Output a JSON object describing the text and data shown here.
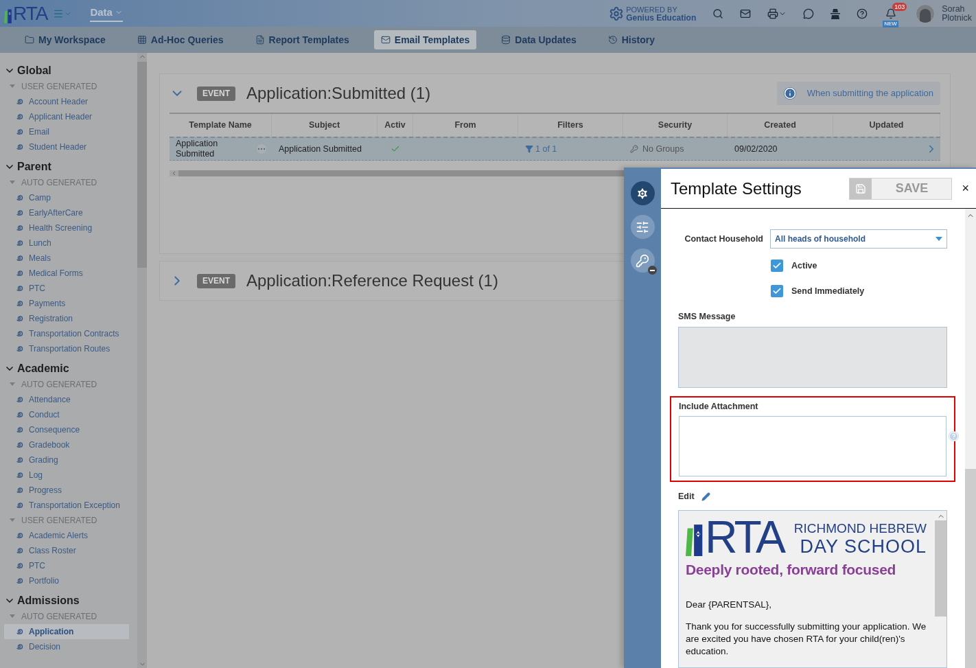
{
  "topbar": {
    "logo": "RTA",
    "menu_label": "Data",
    "powered_by": "POWERED BY",
    "powered_name": "Genius Education",
    "notifications": "103",
    "new_badge": "NEW",
    "user_first": "Sorah",
    "user_last": "Plotnick"
  },
  "nav": [
    {
      "label": "My Workspace",
      "selected": false
    },
    {
      "label": "Ad-Hoc Queries",
      "selected": false
    },
    {
      "label": "Report Templates",
      "selected": false
    },
    {
      "label": "Email Templates",
      "selected": true
    },
    {
      "label": "Data Updates",
      "selected": false
    },
    {
      "label": "History",
      "selected": false
    }
  ],
  "sidebar": [
    {
      "title": "Global",
      "expanded": true,
      "groups": [
        {
          "title": "USER GENERATED",
          "expanded": true,
          "items": [
            {
              "label": "Account Header",
              "selected": false
            },
            {
              "label": "Applicant Header",
              "selected": false
            },
            {
              "label": "Email",
              "selected": false
            },
            {
              "label": "Student Header",
              "selected": false
            }
          ]
        }
      ]
    },
    {
      "title": "Parent",
      "expanded": true,
      "groups": [
        {
          "title": "AUTO GENERATED",
          "expanded": true,
          "items": [
            {
              "label": "Camp",
              "selected": false
            },
            {
              "label": "EarlyAfterCare",
              "selected": false
            },
            {
              "label": "Health Screening",
              "selected": false
            },
            {
              "label": "Lunch",
              "selected": false
            },
            {
              "label": "Meals",
              "selected": false
            },
            {
              "label": "Medical Forms",
              "selected": false
            },
            {
              "label": "PTC",
              "selected": false
            },
            {
              "label": "Payments",
              "selected": false
            },
            {
              "label": "Registration",
              "selected": false
            },
            {
              "label": "Transportation Contracts",
              "selected": false
            },
            {
              "label": "Transportation Routes",
              "selected": false
            }
          ]
        }
      ]
    },
    {
      "title": "Academic",
      "expanded": true,
      "groups": [
        {
          "title": "AUTO GENERATED",
          "expanded": true,
          "items": [
            {
              "label": "Attendance",
              "selected": false
            },
            {
              "label": "Conduct",
              "selected": false
            },
            {
              "label": "Consequence",
              "selected": false
            },
            {
              "label": "Gradebook",
              "selected": false
            },
            {
              "label": "Grading",
              "selected": false
            },
            {
              "label": "Log",
              "selected": false
            },
            {
              "label": "Progress",
              "selected": false
            },
            {
              "label": "Transportation Exception",
              "selected": false
            }
          ]
        },
        {
          "title": "USER GENERATED",
          "expanded": true,
          "items": [
            {
              "label": "Academic Alerts",
              "selected": false
            },
            {
              "label": "Class Roster",
              "selected": false
            },
            {
              "label": "PTC",
              "selected": false
            },
            {
              "label": "Portfolio",
              "selected": false
            }
          ]
        }
      ]
    },
    {
      "title": "Admissions",
      "expanded": true,
      "groups": [
        {
          "title": "AUTO GENERATED",
          "expanded": true,
          "items": [
            {
              "label": "Application",
              "selected": true
            },
            {
              "label": "Decision",
              "selected": false
            }
          ]
        }
      ]
    }
  ],
  "events": [
    {
      "badge": "EVENT",
      "title": "Application:Submitted (1)",
      "expanded": true,
      "info": "When submitting the application",
      "columns": [
        "Template Name",
        "Subject",
        "Activ",
        "From",
        "Filters",
        "Security",
        "Created",
        "Updated"
      ],
      "rows": [
        {
          "name": "Application Submitted",
          "subject": "Application Submitted",
          "active": true,
          "filters": "1 of 1",
          "security": "No Groups",
          "created": "09/02/2020",
          "selected": true
        }
      ]
    },
    {
      "badge": "EVENT",
      "title": "Application:Reference Request (1)",
      "expanded": false
    }
  ],
  "panel": {
    "title": "Template Settings",
    "save": "SAVE",
    "close": "×",
    "contact_household": {
      "label": "Contact Household",
      "value": "All heads of household"
    },
    "checkboxes": [
      {
        "label": "Active",
        "checked": true
      },
      {
        "label": "Send Immediately",
        "checked": true
      }
    ],
    "sms": {
      "label": "SMS Message",
      "disabled": true
    },
    "attachment": {
      "label": "Include Attachment",
      "highlighted": true
    },
    "edit_label": "Edit",
    "email": {
      "logo": "RTA",
      "school_line1": "RICHMOND HEBREW",
      "school_line2": "DAY SCHOOL",
      "tagline": "Deeply rooted, forward focused",
      "greeting": "Dear {PARENTSAL},",
      "body": "Thank you for successfully submitting your application. We are excited you have chosen RTA for your child(ren)'s education."
    }
  }
}
